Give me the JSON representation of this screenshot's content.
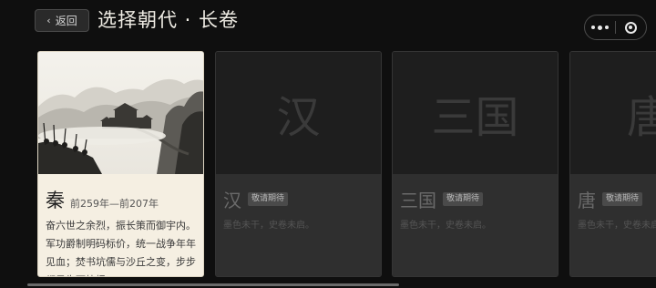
{
  "header": {
    "back_label": "返回",
    "title": "选择朝代 · 长卷"
  },
  "capsule": {
    "more_icon": "more-dots-icon",
    "close_icon": "target-circle-icon"
  },
  "cards": [
    {
      "name": "秦",
      "years": "前259年—前207年",
      "description": "奋六世之余烈，振长策而御宇内。军功爵制明码标价，统一战争年年见血；焚书坑儒与沙丘之变，步步都是生死抉择。",
      "state": "active"
    },
    {
      "watermark": "汉",
      "name": "汉",
      "badge": "敬请期待",
      "subtitle": "墨色未干，史卷未启。",
      "state": "locked"
    },
    {
      "watermark": "三国",
      "name": "三国",
      "badge": "敬请期待",
      "subtitle": "墨色未干，史卷未启。",
      "state": "locked"
    },
    {
      "watermark": "唐",
      "name": "唐",
      "badge": "敬请期待",
      "subtitle": "墨色未干，史卷未启。",
      "state": "locked"
    }
  ],
  "colors": {
    "background": "#0f0f0f",
    "active_card": "#f5efe2",
    "locked_card": "#262626",
    "badge": "#4a4a4a"
  }
}
